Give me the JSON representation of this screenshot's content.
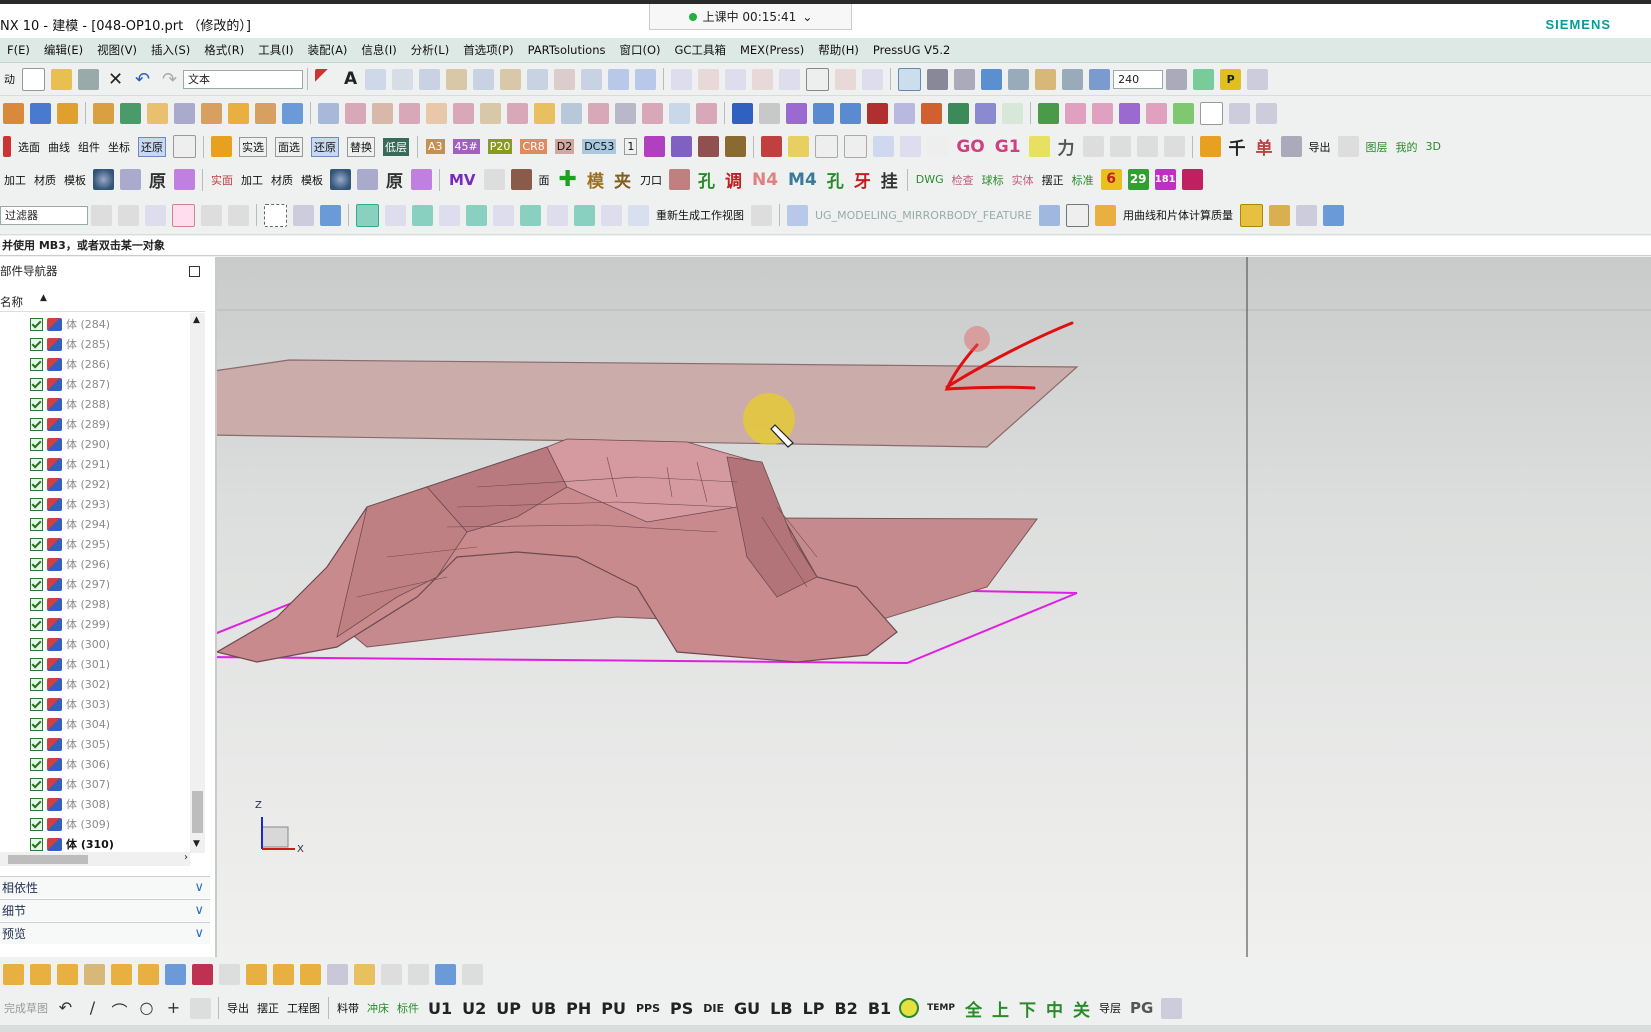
{
  "window": {
    "title": "NX 10 - 建模 - [048-OP10.prt （修改的）]",
    "brand": "SIEMENS",
    "timer": "上课中 00:15:41"
  },
  "menubar": [
    "F(E)",
    "编辑(E)",
    "视图(V)",
    "插入(S)",
    "格式(R)",
    "工具(I)",
    "装配(A)",
    "信息(I)",
    "分析(L)",
    "首选项(P)",
    "PARTsolutions",
    "窗口(O)",
    "GC工具箱",
    "MEX(Press)",
    "帮助(H)",
    "PressUG V5.2"
  ],
  "toolbar1": {
    "start_label": "动",
    "text_field": "文本",
    "zoom_value": "240"
  },
  "toolbar3_labels": [
    "选面",
    "曲线",
    "组件",
    "坐标",
    "还原",
    "实选",
    "面选",
    "还原",
    "替换",
    "低层",
    "A3",
    "45#",
    "P20",
    "CR8",
    "D2",
    "DC53",
    "1",
    "千"
  ],
  "toolbar4_labels": [
    "加工",
    "材质",
    "模板",
    "原",
    "实面",
    "加工",
    "材质",
    "模板",
    "原",
    "MV",
    "面",
    "模",
    "夹",
    "刀口",
    "孔",
    "调",
    "N4",
    "M4",
    "孔",
    "牙",
    "挂",
    "DWG",
    "检查",
    "球标",
    "实体",
    "摆正",
    "标准",
    "6",
    "29",
    "181"
  ],
  "toolbar5": {
    "filter": "过滤器",
    "regen_label": "重新生成工作视图",
    "feature_label": "UG_MODELING_MIRRORBODY_FEATURE",
    "mass_label": "用曲线和片体计算质量"
  },
  "hint": "并使用 MB3，或者双击某一对象",
  "navigator": {
    "title": "部件导航器",
    "column": "名称",
    "items": [
      "体 (284)",
      "体 (285)",
      "体 (286)",
      "体 (287)",
      "体 (288)",
      "体 (289)",
      "体 (290)",
      "体 (291)",
      "体 (292)",
      "体 (293)",
      "体 (294)",
      "体 (295)",
      "体 (296)",
      "体 (297)",
      "体 (298)",
      "体 (299)",
      "体 (300)",
      "体 (301)",
      "体 (302)",
      "体 (303)",
      "体 (304)",
      "体 (305)",
      "体 (306)",
      "体 (307)",
      "体 (308)",
      "体 (309)",
      "体 (310)"
    ],
    "panels": [
      "相依性",
      "细节",
      "预览"
    ]
  },
  "triad": {
    "z": "Z",
    "x": "X"
  },
  "bottom_toolbar1": {},
  "bottom_toolbar2": {
    "labels": [
      "完成草图",
      "导出",
      "摆正",
      "工程图",
      "料带",
      "冲床",
      "标件",
      "U1",
      "U2",
      "UP",
      "UB",
      "PH",
      "PU",
      "PPS",
      "PS",
      "DIE",
      "GU",
      "LB",
      "LP",
      "B2",
      "B1",
      "TEMP",
      "全",
      "上",
      "下",
      "中",
      "关",
      "导层",
      "PG"
    ]
  },
  "colors": {
    "menubar_bg": "#dde9e4",
    "part_fill": "#c98a8e",
    "sheet_fill": "#c8a8a4",
    "datum_magenta": "#e020e0",
    "annotation_red": "#e01010",
    "siemens_teal": "#0a9a9a"
  }
}
